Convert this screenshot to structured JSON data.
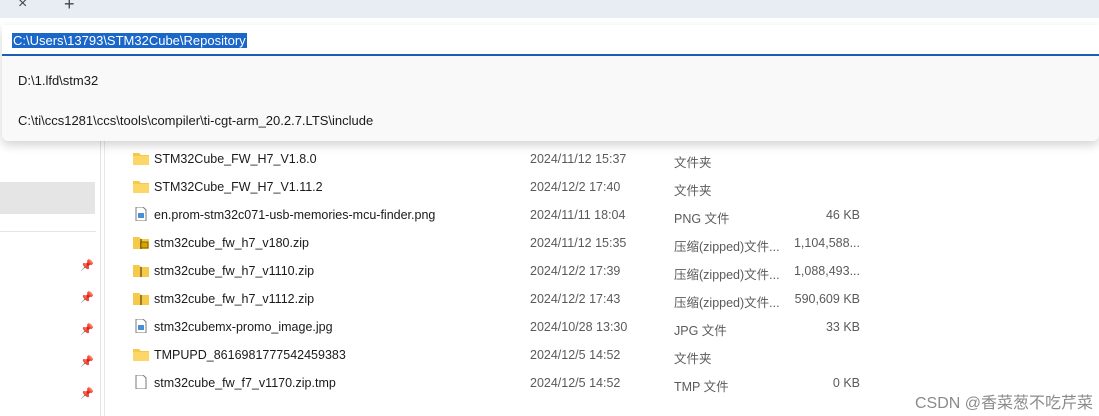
{
  "tabstrip": {
    "close_glyph": "×",
    "new_glyph": "+"
  },
  "address_bar": {
    "value": "C:\\Users\\13793\\STM32Cube\\Repository",
    "suggestions": [
      "D:\\1.lfd\\stm32",
      "C:\\ti\\ccs1281\\ccs\\tools\\compiler\\ti-cgt-arm_20.2.7.LTS\\include"
    ]
  },
  "files": [
    {
      "name": "STM32Cube_FW_H7_V1.8.0",
      "date": "2024/11/12 15:37",
      "type": "文件夹",
      "size": "",
      "icon": "folder-icon"
    },
    {
      "name": "STM32Cube_FW_H7_V1.11.2",
      "date": "2024/12/2 17:40",
      "type": "文件夹",
      "size": "",
      "icon": "folder-icon"
    },
    {
      "name": "en.prom-stm32c071-usb-memories-mcu-finder.png",
      "date": "2024/11/11 18:04",
      "type": "PNG 文件",
      "size": "46 KB",
      "icon": "image-file-icon"
    },
    {
      "name": "stm32cube_fw_h7_v180.zip",
      "date": "2024/11/12 15:35",
      "type": "压缩(zipped)文件...",
      "size": "1,104,588...",
      "icon": "zip-locked-icon"
    },
    {
      "name": "stm32cube_fw_h7_v1110.zip",
      "date": "2024/12/2 17:39",
      "type": "压缩(zipped)文件...",
      "size": "1,088,493...",
      "icon": "zip-folder-icon"
    },
    {
      "name": "stm32cube_fw_h7_v1112.zip",
      "date": "2024/12/2 17:43",
      "type": "压缩(zipped)文件...",
      "size": "590,609 KB",
      "icon": "zip-folder-icon"
    },
    {
      "name": "stm32cubemx-promo_image.jpg",
      "date": "2024/10/28 13:30",
      "type": "JPG 文件",
      "size": "33 KB",
      "icon": "image-file-icon"
    },
    {
      "name": "TMPUPD_8616981777542459383",
      "date": "2024/12/5 14:52",
      "type": "文件夹",
      "size": "",
      "icon": "folder-icon"
    },
    {
      "name": "stm32cube_fw_f7_v1170.zip.tmp",
      "date": "2024/12/5 14:52",
      "type": "TMP 文件",
      "size": "0 KB",
      "icon": "blank-file-icon"
    }
  ],
  "colors": {
    "selection": "#1a66c9",
    "folder": "#f7c948",
    "accent": "#1a5fb4"
  },
  "watermark": "CSDN @香菜葱不吃芹菜"
}
